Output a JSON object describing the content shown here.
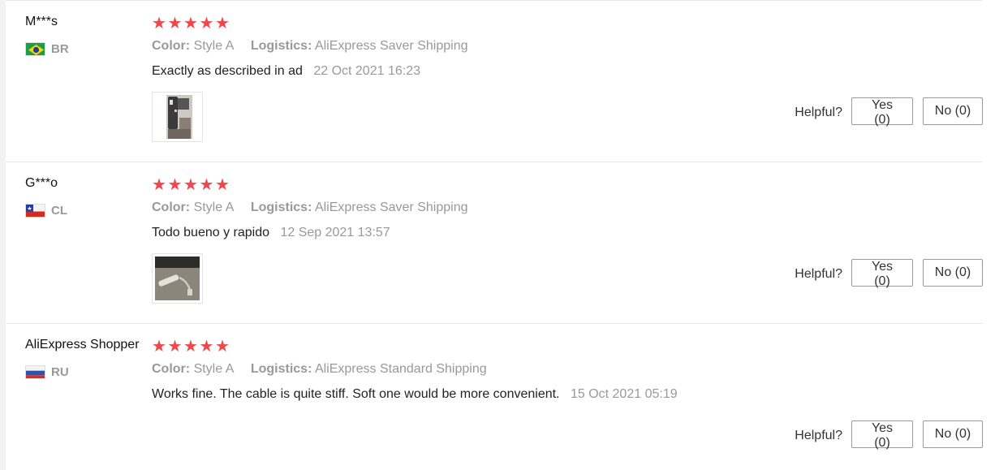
{
  "reviews": [
    {
      "user": "M***s",
      "country_code": "BR",
      "flag": "brazil-flag-icon",
      "rating": 5,
      "color_label": "Color:",
      "color_value": "Style A",
      "logistics_label": "Logistics:",
      "logistics_value": "AliExpress Saver Shipping",
      "text": "Exactly as described in ad",
      "date": "22 Oct 2021 16:23",
      "has_photo": true,
      "helpful_label": "Helpful?",
      "yes_label": "Yes (0)",
      "no_label": "No (0)"
    },
    {
      "user": "G***o",
      "country_code": "CL",
      "flag": "chile-flag-icon",
      "rating": 5,
      "color_label": "Color:",
      "color_value": "Style A",
      "logistics_label": "Logistics:",
      "logistics_value": "AliExpress Saver Shipping",
      "text": "Todo bueno y rapido",
      "date": "12 Sep 2021 13:57",
      "has_photo": true,
      "helpful_label": "Helpful?",
      "yes_label": "Yes (0)",
      "no_label": "No (0)"
    },
    {
      "user": "AliExpress Shopper",
      "country_code": "RU",
      "flag": "russia-flag-icon",
      "rating": 5,
      "color_label": "Color:",
      "color_value": "Style A",
      "logistics_label": "Logistics:",
      "logistics_value": "AliExpress Standard Shipping",
      "text": "Works fine. The cable is quite stiff. Soft one would be more convenient.",
      "date": "15 Oct 2021 05:19",
      "has_photo": false,
      "helpful_label": "Helpful?",
      "yes_label": "Yes (0)",
      "no_label": "No (0)"
    }
  ],
  "colors": {
    "star": "#f0474a",
    "muted_text": "#999999",
    "divider": "#e8e8e8"
  }
}
